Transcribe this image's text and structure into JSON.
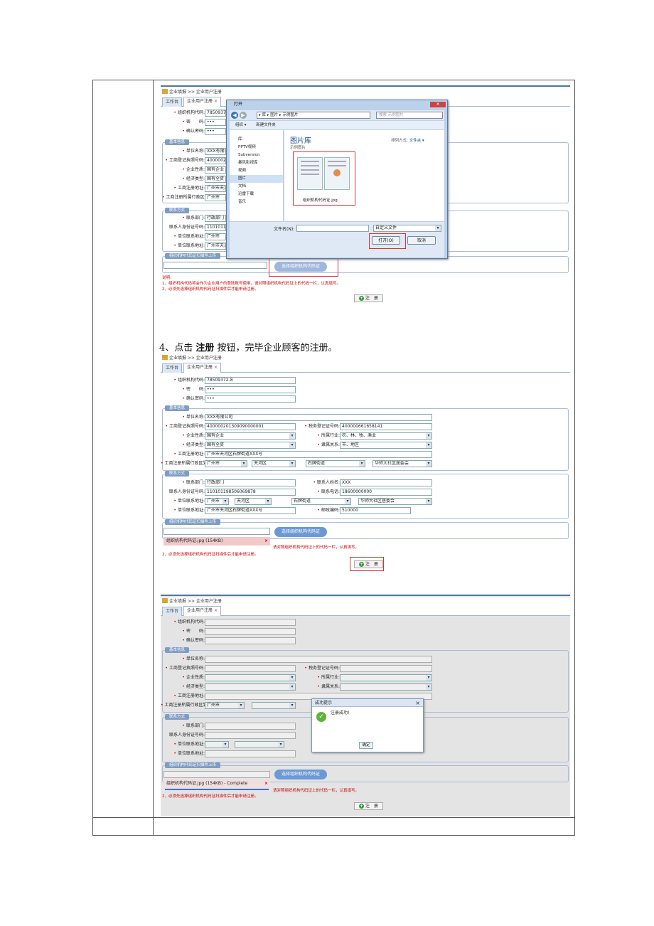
{
  "step_text": {
    "prefix": "4、点击 ",
    "bold": "注册",
    "suffix": " 按钮，完毕企业顾客的注册。"
  },
  "breadcrumb": {
    "root": "企业填报",
    "sep": ">>",
    "page": "企业用户注册"
  },
  "tabs": {
    "workbench": "工作台",
    "register": "企业用户注册",
    "close": "×"
  },
  "fields": {
    "org_code": "组织机构代码:",
    "password": "密　　码:",
    "confirm_password": "确认密码:",
    "unit_name": "单位名称:",
    "biz_license": "工商登记执照号码:",
    "tax_reg": "税务登记证号码:",
    "enterprise_type": "企业性质:",
    "industry": "所属行业:",
    "economy_type": "经济类型:",
    "affiliation": "隶属关系:",
    "reg_address": "工商注册地址:",
    "reg_region": "工商注册所属行政区划:",
    "contact_dept": "联系部门:",
    "contact_name": "联系人姓名:",
    "contact_id": "联系人身份证号码:",
    "contact_phone": "联系电话:",
    "unit_contact_addr": "单位联系地址:",
    "unit_address": "单位联系地址:",
    "postcode": "邮政编码:"
  },
  "values": {
    "org_code": "78509372-8",
    "password": "•••",
    "confirm_password": "•••",
    "unit_name": "XXX有限公司",
    "biz_license": "400000201309090000001",
    "tax_reg": "400000661658141",
    "enterprise_type": "国有企业",
    "industry": "农、林、牧、渔业",
    "economy_type": "国有全资",
    "affiliation": "市、地区",
    "reg_address": "广州市天河区石牌街道XXX号",
    "region_city": "广州市",
    "region_district": "天河区",
    "region_street": "石牌街道",
    "region_community": "华师大社区居委会",
    "contact_dept": "行政部门",
    "contact_name": "XXX",
    "contact_id": "110101198506069878",
    "contact_phone": "18600000000",
    "contact_city": "广州市",
    "contact_district": "天河区",
    "contact_street": "石牌街道",
    "contact_community": "华师大社区居委会",
    "unit_address": "广州市天河区石牌街道XXX号",
    "postcode": "510000"
  },
  "sections": {
    "basic": "基本信息",
    "contact": "联系方式",
    "upload": "组织机构代码证扫描件上传"
  },
  "upload_button": "选择组织机构代码证",
  "file": {
    "name": "组织机构代码证.jpg (154KB)",
    "complete": "组织机构代码证.jpg (154KB) - Complete",
    "delete": "×"
  },
  "notes": {
    "title": "说明:",
    "line1": "1、组织机构代码将会作为企业用户的登陆账号使用，请对照组织机构代码证上的代码一栏，认真填写。",
    "line1_tail": "请对照组织机构代码证上的代码一栏，认真填写。",
    "line2": "2、必须先选择组织机构代码证扫描件后才能申请注册。"
  },
  "register_button": "注　册",
  "dialog": {
    "title": "打开",
    "close": "✕",
    "path": "▸ 库 ▸ 图片 ▸ 示例图片",
    "search": "搜索 示例图片",
    "organize": "组织 ▾",
    "new_folder": "新建文件夹",
    "library_title": "图片库",
    "library_sub": "示例图片",
    "sort_by": "排列方式:",
    "sort_value": "文件夹 ▾",
    "nav": [
      "库",
      "PPTV视频",
      "Subversion",
      "暴风影视库",
      "视频",
      "图片",
      "文档",
      "迅雷下载",
      "音乐"
    ],
    "file_label": "组织机构代码证.jpg",
    "filename_label": "文件名(N):",
    "filter": "自定义文件",
    "open": "打开(O)",
    "cancel": "取消"
  },
  "success": {
    "title": "成功提示",
    "message": "注册成功!",
    "ok": "确定",
    "close": "×"
  }
}
